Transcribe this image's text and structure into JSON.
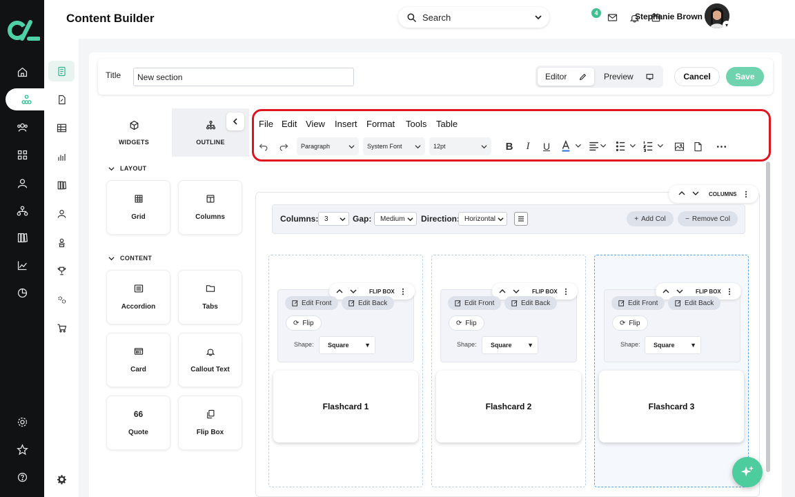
{
  "header": {
    "page_title": "Content Builder",
    "search_label": "Search",
    "notifications_count": "4",
    "user_name": "Stephanie Brown"
  },
  "form": {
    "title_label": "Title",
    "title_value": "New section",
    "editor_label": "Editor",
    "preview_label": "Preview",
    "cancel_label": "Cancel",
    "save_label": "Save"
  },
  "sidebar": {
    "tabs": [
      "WIDGETS",
      "OUTLINE"
    ],
    "layout_heading": "LAYOUT",
    "content_heading": "CONTENT",
    "layout_items": [
      "Grid",
      "Columns"
    ],
    "content_items": [
      "Accordion",
      "Tabs",
      "Card",
      "Callout Text",
      "Quote",
      "Flip Box"
    ],
    "quote_glyph": "66"
  },
  "editor": {
    "menu": [
      "File",
      "Edit",
      "View",
      "Insert",
      "Format",
      "Tools",
      "Table"
    ],
    "block_format": "Paragraph",
    "font_family": "System Font",
    "font_size": "12pt"
  },
  "columns_block": {
    "label": "COLUMNS",
    "columns_label": "Columns:",
    "columns_value": "3",
    "gap_label": "Gap:",
    "gap_value": "Medium",
    "direction_label": "Direction:",
    "direction_value": "Horizontal",
    "add_col_label": "Add Col",
    "remove_col_label": "Remove Col"
  },
  "flip_boxes": [
    {
      "label": "FLIP BOX",
      "edit_front": "Edit Front",
      "edit_back": "Edit Back",
      "flip": "Flip",
      "shape_label": "Shape:",
      "shape_value": "Square",
      "card_text": "Flashcard 1"
    },
    {
      "label": "FLIP BOX",
      "edit_front": "Edit Front",
      "edit_back": "Edit Back",
      "flip": "Flip",
      "shape_label": "Shape:",
      "shape_value": "Square",
      "card_text": "Flashcard 2"
    },
    {
      "label": "FLIP BOX",
      "edit_front": "Edit Front",
      "edit_back": "Edit Back",
      "flip": "Flip",
      "shape_label": "Shape:",
      "shape_value": "Square",
      "card_text": "Flashcard 3"
    }
  ],
  "colors": {
    "accent": "#2bb88e",
    "save_button": "#6fd3ad",
    "rail": "#111214",
    "highlight_border": "#e0141e"
  },
  "icons": {
    "rail": [
      "home-icon",
      "org-chart-icon",
      "users-icon",
      "apps-grid-icon",
      "bar-chart-icon",
      "user-icon",
      "hierarchy-icon",
      "library-icon",
      "trend-icon",
      "pie-chart-icon",
      "settings-icon",
      "star-icon",
      "help-icon"
    ]
  }
}
